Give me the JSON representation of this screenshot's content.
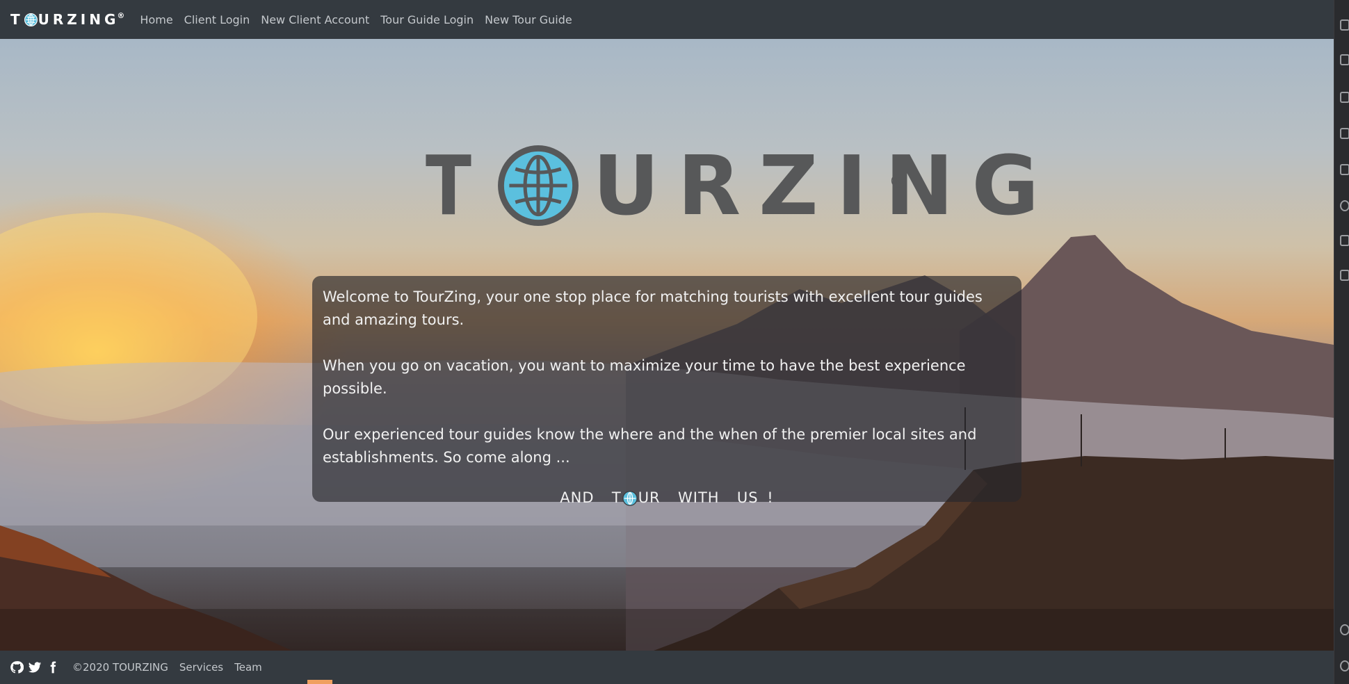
{
  "navbar": {
    "brand": {
      "pre": "T",
      "post": "URZING",
      "reg": "®"
    },
    "links": [
      {
        "label": "Home"
      },
      {
        "label": "Client Login"
      },
      {
        "label": "New Client Account"
      },
      {
        "label": "Tour Guide Login"
      },
      {
        "label": "New Tour Guide"
      }
    ]
  },
  "hero": {
    "logo": {
      "pre": "T",
      "post": "URZING",
      "reg": "®"
    },
    "welcome": {
      "p1": "Welcome to TourZing, your one stop place for matching tourists with excellent tour guides and amazing tours.",
      "p2": "When you go on vacation, you want to maximize your time to have the best experience possible.",
      "p3": "Our experienced tour guides know the where and the when of the premier local sites and establishments. So come along ...",
      "tagline_pre": "AND  T",
      "tagline_post": "UR  WITH  US !"
    }
  },
  "footer": {
    "social_icons": [
      "github-icon",
      "twitter-icon",
      "facebook-icon"
    ],
    "copyright": "©2020 TOURZING",
    "links": [
      {
        "label": "Services"
      },
      {
        "label": "Team"
      }
    ]
  },
  "colors": {
    "navbar_bg": "#343a40",
    "globe_blue": "#5bc0de",
    "logo_gray": "#575859"
  }
}
